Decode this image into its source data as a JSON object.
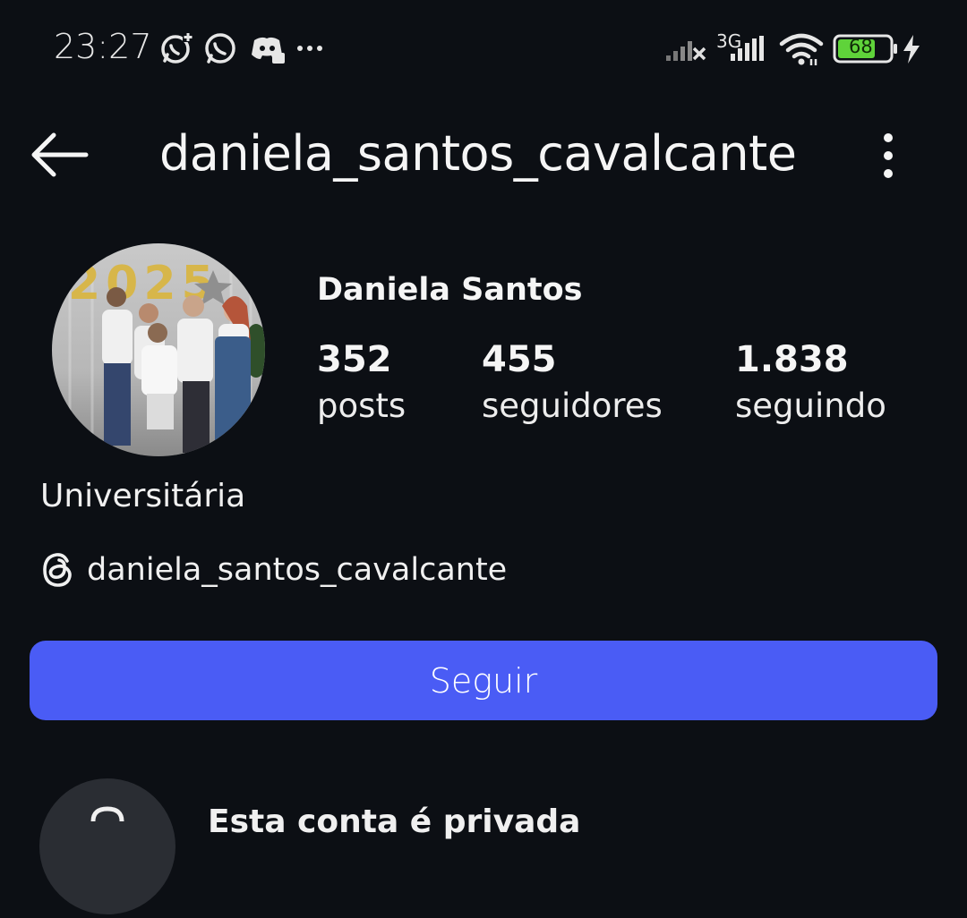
{
  "status_bar": {
    "time": "23:27",
    "network_label": "3G",
    "battery_level": "68",
    "notification_icons": [
      "whatsapp-plus-icon",
      "whatsapp-icon",
      "discord-icon",
      "more-dots-icon"
    ],
    "battery_color": "#5fd33a"
  },
  "header": {
    "username": "daniela_santos_cavalcante"
  },
  "profile": {
    "display_name": "Daniela Santos",
    "stats": [
      {
        "value": "352",
        "label": "posts"
      },
      {
        "value": "455",
        "label": "seguidores"
      },
      {
        "value": "1.838",
        "label": "seguindo"
      }
    ],
    "bio": "Universitária",
    "threads_handle": "daniela_santos_cavalcante",
    "avatar_balloon_text": "2025"
  },
  "actions": {
    "follow_label": "Seguir",
    "follow_color": "#4a5cf5"
  },
  "private_notice": {
    "text": "Esta conta é privada"
  }
}
